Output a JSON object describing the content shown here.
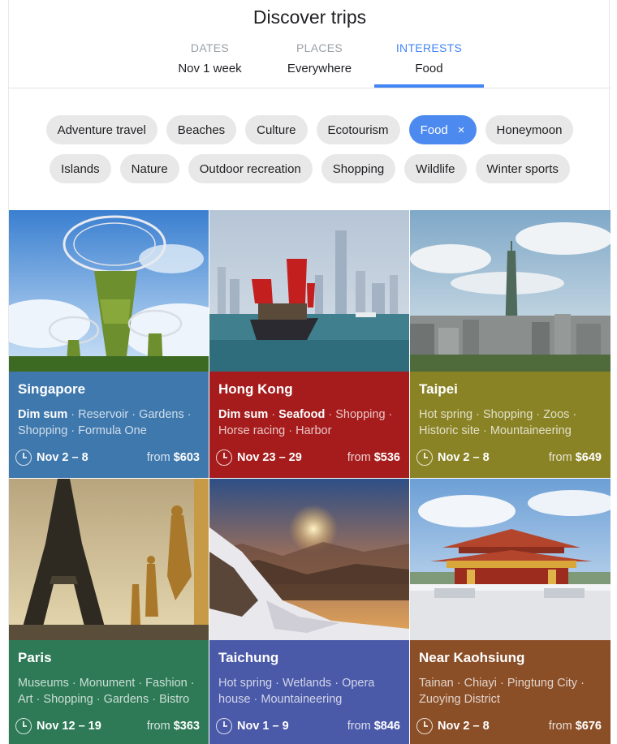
{
  "header": {
    "title": "Discover trips"
  },
  "tabs": [
    {
      "label": "DATES",
      "value": "Nov 1 week"
    },
    {
      "label": "PLACES",
      "value": "Everywhere"
    },
    {
      "label": "INTERESTS",
      "value": "Food",
      "active": true
    }
  ],
  "filters": {
    "row1": [
      "Adventure travel",
      "Beaches",
      "Culture",
      "Ecotourism",
      "Food",
      "Honeymoon"
    ],
    "row2": [
      "Islands",
      "Nature",
      "Outdoor recreation",
      "Shopping",
      "Wildlife",
      "Winter sports"
    ],
    "selected": "Food",
    "clear_glyph": "×"
  },
  "price_prefix": "from",
  "separator": " · ",
  "destinations": [
    {
      "city": "Singapore",
      "color": "#3f78ad",
      "tags_bold": [
        "Dim sum"
      ],
      "tags": [
        "Reservoir",
        "Gardens",
        "Shopping",
        "Formula One"
      ],
      "dates": "Nov 2 – 8",
      "price": "$603",
      "icon": "clock-icon"
    },
    {
      "city": "Hong Kong",
      "color": "#a61c1c",
      "tags_bold": [
        "Dim sum",
        "Seafood"
      ],
      "tags": [
        "Shopping",
        "Horse racing",
        "Harbor"
      ],
      "dates": "Nov 23 – 29",
      "price": "$536",
      "icon": "clock-icon"
    },
    {
      "city": "Taipei",
      "color": "#8a8325",
      "tags_bold": [],
      "tags": [
        "Hot spring",
        "Shopping",
        "Zoos",
        "Historic site",
        "Mountaineering"
      ],
      "dates": "Nov 2 – 8",
      "price": "$649",
      "icon": "clock-icon"
    },
    {
      "city": "Paris",
      "color": "#2e7a57",
      "tags_bold": [],
      "tags": [
        "Museums",
        "Monument",
        "Fashion",
        "Art",
        "Shopping",
        "Gardens",
        "Bistro"
      ],
      "dates": "Nov 12 – 19",
      "price": "$363",
      "icon": "clock-icon"
    },
    {
      "city": "Taichung",
      "color": "#4a59a8",
      "tags_bold": [],
      "tags": [
        "Hot spring",
        "Wetlands",
        "Opera house",
        "Mountaineering"
      ],
      "dates": "Nov 1 – 9",
      "price": "$846",
      "icon": "clock-icon"
    },
    {
      "city": "Near Kaohsiung",
      "color": "#8b4f28",
      "tags_bold": [],
      "tags": [
        "Tainan",
        "Chiayi",
        "Pingtung City",
        "Zuoying District"
      ],
      "dates": "Nov 2 – 8",
      "price": "$676",
      "icon": "clock-icon"
    }
  ]
}
